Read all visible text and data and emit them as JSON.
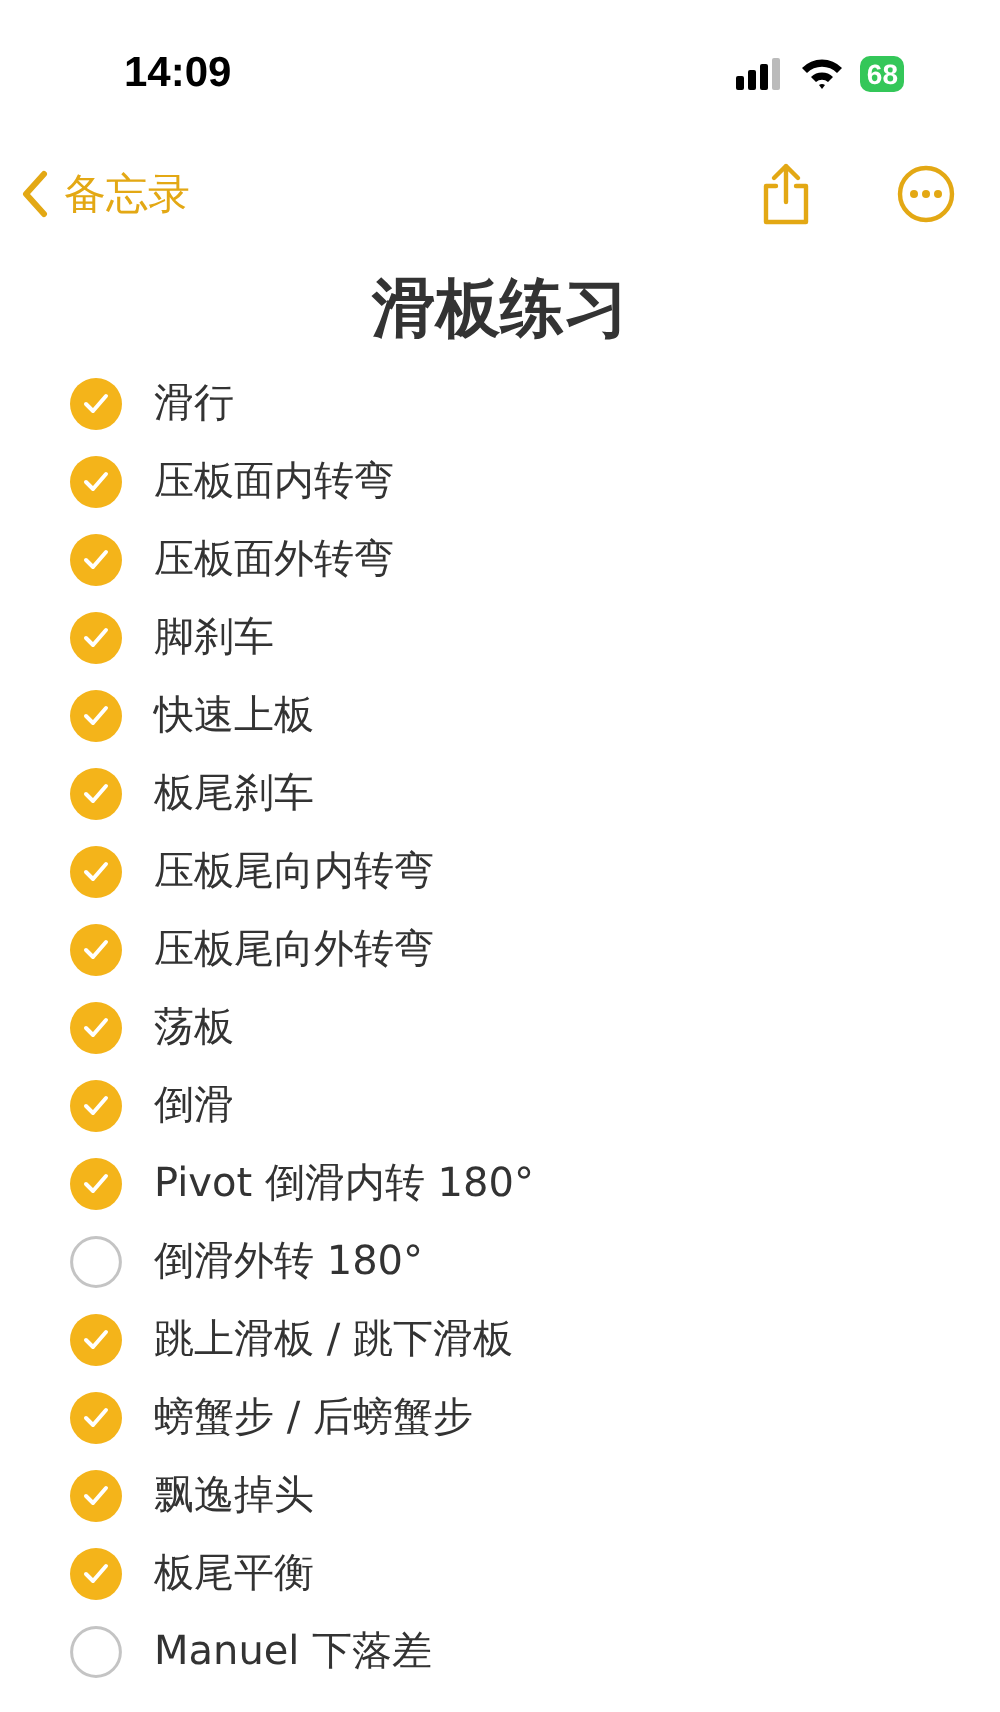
{
  "status_bar": {
    "time": "14:09",
    "battery": "68"
  },
  "nav": {
    "back_label": "备忘录"
  },
  "title": "滑板练习",
  "checklist": [
    {
      "text": "滑行",
      "checked": true
    },
    {
      "text": "压板面内转弯",
      "checked": true
    },
    {
      "text": "压板面外转弯",
      "checked": true
    },
    {
      "text": "脚刹车",
      "checked": true
    },
    {
      "text": "快速上板",
      "checked": true
    },
    {
      "text": "板尾刹车",
      "checked": true
    },
    {
      "text": "压板尾向内转弯",
      "checked": true
    },
    {
      "text": "压板尾向外转弯",
      "checked": true
    },
    {
      "text": "荡板",
      "checked": true
    },
    {
      "text": "倒滑",
      "checked": true
    },
    {
      "text": "Pivot 倒滑内转 180°",
      "checked": true
    },
    {
      "text": "倒滑外转 180°",
      "checked": false
    },
    {
      "text": "跳上滑板 / 跳下滑板",
      "checked": true
    },
    {
      "text": "螃蟹步 / 后螃蟹步",
      "checked": true
    },
    {
      "text": "飘逸掉头",
      "checked": true
    },
    {
      "text": "板尾平衡",
      "checked": true
    },
    {
      "text": "Manuel 下落差",
      "checked": false
    }
  ]
}
